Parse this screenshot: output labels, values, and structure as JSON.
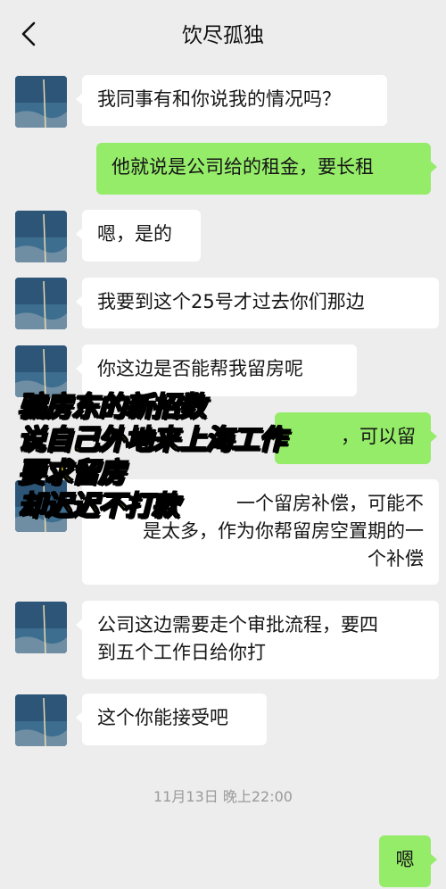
{
  "header": {
    "title": "饮尽孤独",
    "back_icon": "chevron-left-icon"
  },
  "messages": [
    {
      "side": "in",
      "text": "我同事有和你说我的情况吗？"
    },
    {
      "side": "out",
      "text": "他就说是公司给的租金，要长租"
    },
    {
      "side": "in",
      "text": "嗯，是的"
    },
    {
      "side": "in",
      "text": "我要到这个25号才过去你们那边"
    },
    {
      "side": "in",
      "text": "你这边是否能帮我留房呢"
    },
    {
      "side": "out",
      "text": "，可以留"
    },
    {
      "side": "in",
      "text": "一个留房补偿，可能不\n是太多，作为你帮留房空置期的一\n个补偿"
    },
    {
      "side": "in",
      "text": "公司这边需要走个审批流程，要四\n到五个工作日给你打"
    },
    {
      "side": "in",
      "text": "这个你能接受吧"
    },
    {
      "side": "out",
      "text": "嗯"
    }
  ],
  "timestamp": "11月13日 晚上22:00",
  "overlay": {
    "lines": [
      "骗房东的新招数",
      "说自己外地来上海工作",
      "要求留房",
      "却迟迟不打款"
    ],
    "color": "#ffe01b"
  },
  "colors": {
    "background": "#ededed",
    "incoming_bubble": "#ffffff",
    "outgoing_bubble": "#95ec69"
  }
}
